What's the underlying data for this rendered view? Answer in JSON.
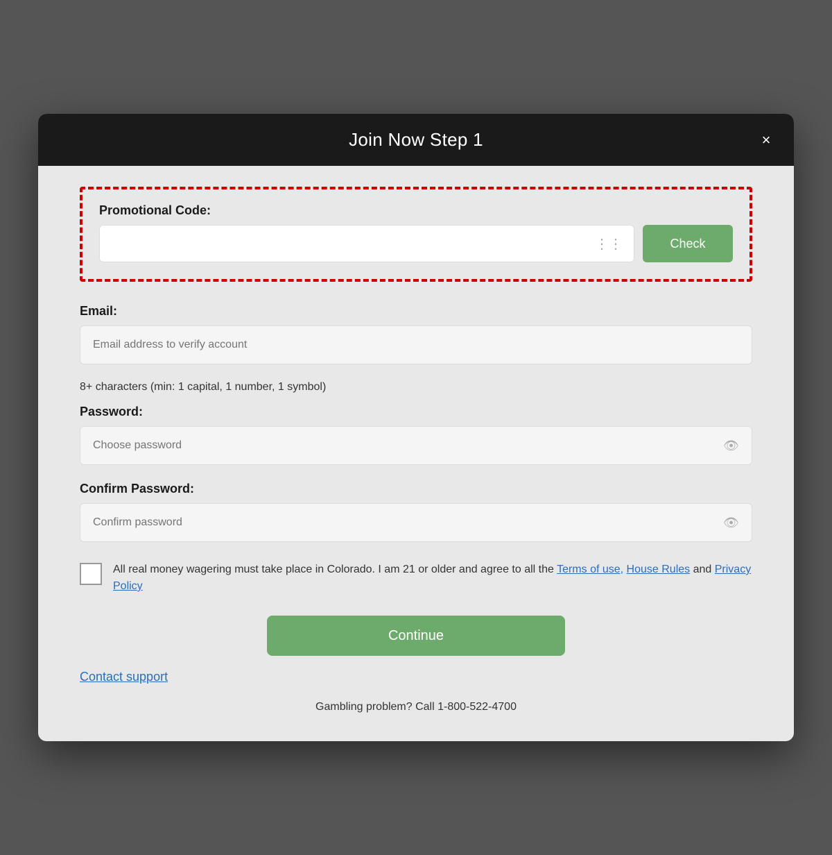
{
  "modal": {
    "title": "Join Now Step 1",
    "close_label": "×"
  },
  "promo": {
    "label": "Promotional Code:",
    "input_placeholder": "",
    "check_button_label": "Check"
  },
  "email": {
    "label": "Email:",
    "input_placeholder": "Email address to verify account"
  },
  "password_hint": "8+ characters (min: 1 capital, 1 number, 1 symbol)",
  "password": {
    "label": "Password:",
    "input_placeholder": "Choose password"
  },
  "confirm_password": {
    "label": "Confirm Password:",
    "input_placeholder": "Confirm password"
  },
  "checkbox": {
    "text_before": "All real money wagering must take place in Colorado. I am 21 or older and agree to all the ",
    "terms_label": "Terms of use,",
    "house_rules_label": "House Rules",
    "text_middle": " and ",
    "privacy_label": "Privacy Policy"
  },
  "continue_button_label": "Continue",
  "contact_support_label": "Contact support",
  "gambling_notice": "Gambling problem? Call 1-800-522-4700"
}
